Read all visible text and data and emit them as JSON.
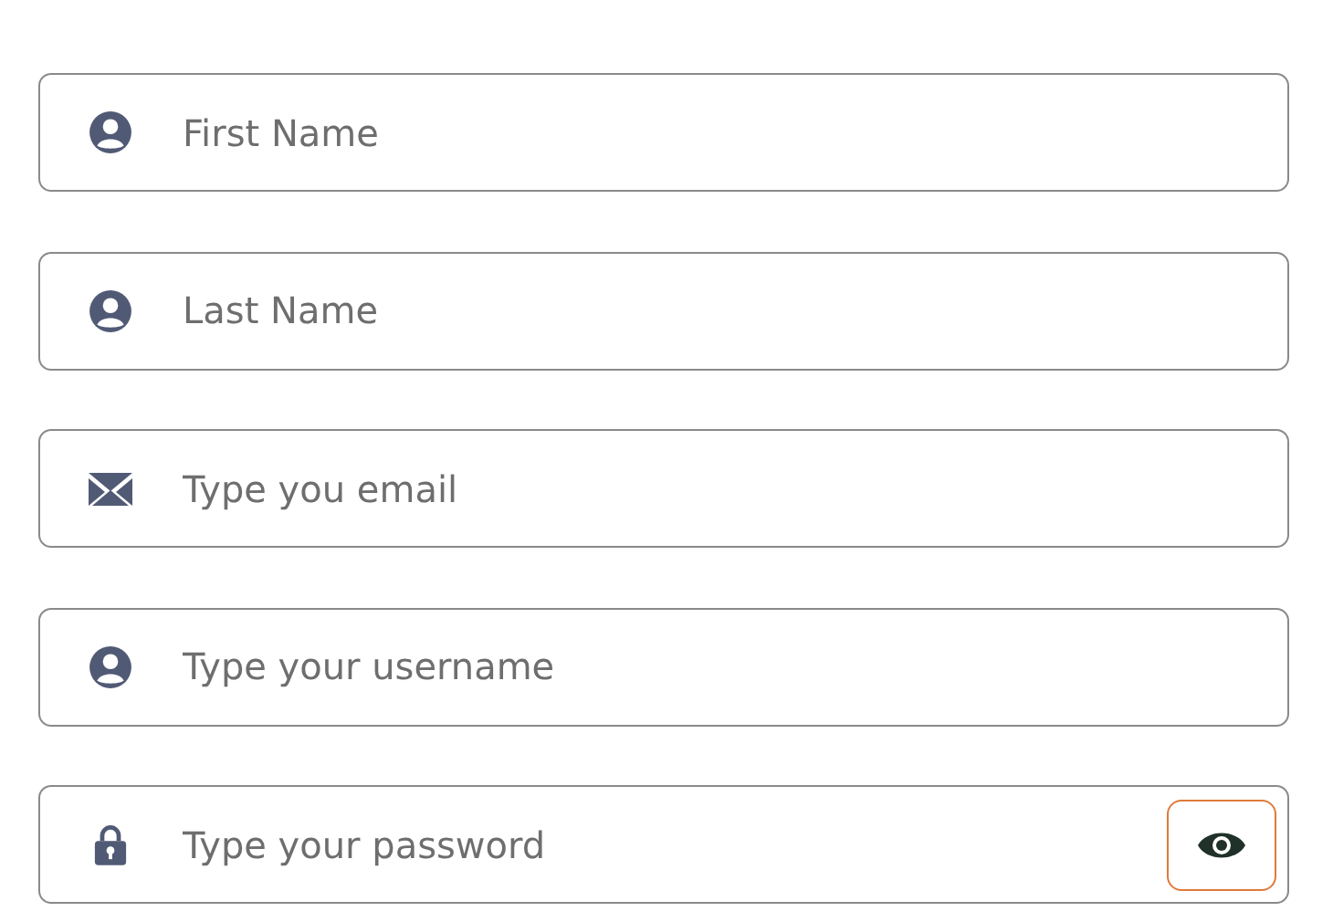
{
  "fields": [
    {
      "kind": "person",
      "placeholder": "First Name"
    },
    {
      "kind": "person",
      "placeholder": "Last Name"
    },
    {
      "kind": "mail",
      "placeholder": "Type you email"
    },
    {
      "kind": "person",
      "placeholder": "Type your username"
    },
    {
      "kind": "lock",
      "placeholder": "Type your password",
      "reveal_button": {
        "focused": true
      }
    }
  ]
}
